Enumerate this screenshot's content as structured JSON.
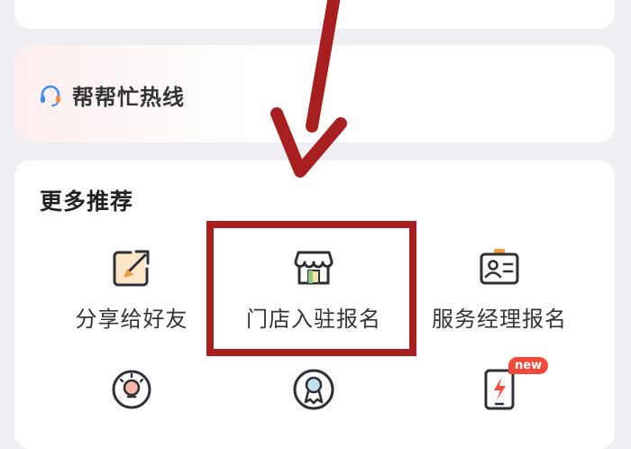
{
  "hotline": {
    "label": "帮帮忙热线",
    "icon": "headset-icon"
  },
  "more_recommendations": {
    "title": "更多推荐",
    "items": [
      {
        "label": "分享给好友",
        "icon": "share-pen-icon"
      },
      {
        "label": "门店入驻报名",
        "icon": "storefront-icon"
      },
      {
        "label": "服务经理报名",
        "icon": "id-card-icon"
      },
      {
        "label": "",
        "icon": "lightbulb-icon"
      },
      {
        "label": "",
        "icon": "award-ribbon-icon"
      },
      {
        "label": "",
        "icon": "tablet-lightning-icon",
        "badge": "new"
      }
    ]
  },
  "colors": {
    "annotation_red": "#a81f1f",
    "badge_red": "#f04a3a",
    "accent_blue": "#3a8ef0",
    "icon_dark": "#2f2f36",
    "icon_orange": "#f19a3e"
  }
}
